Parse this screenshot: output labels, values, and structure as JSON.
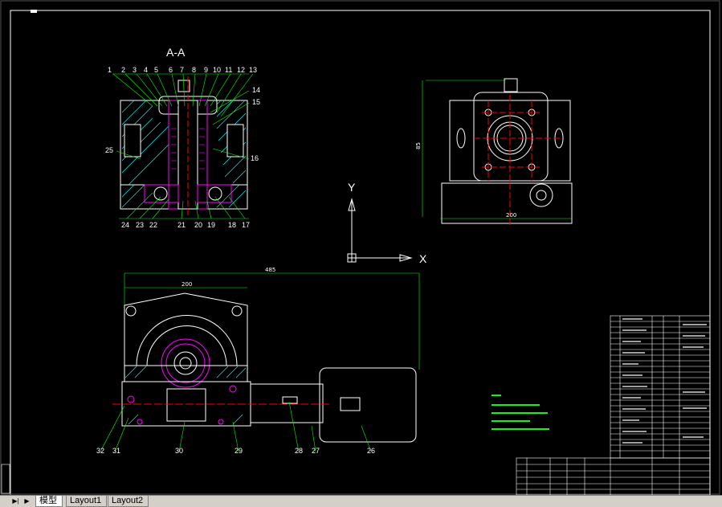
{
  "section_label": "A-A",
  "axis": {
    "x": "X",
    "y": "Y"
  },
  "part_numbers_top": [
    "1",
    "2",
    "3",
    "4",
    "5",
    "6",
    "7",
    "8",
    "9",
    "10",
    "11",
    "12",
    "13"
  ],
  "part_numbers_right": [
    "14",
    "15",
    "16",
    "17"
  ],
  "part_numbers_bottom": [
    "24",
    "23",
    "22",
    "21",
    "20",
    "19",
    "18",
    "17"
  ],
  "part_number_left": "25",
  "plan_part_numbers": [
    "32",
    "31",
    "30",
    "29",
    "28",
    "27",
    "26"
  ],
  "dims": {
    "top_view_width": "200",
    "top_view_height": "85",
    "plan_overall": "485",
    "plan_body": "200"
  },
  "tabs": {
    "model": "模型",
    "layout1": "Layout1",
    "layout2": "Layout2"
  },
  "colors": {
    "border": "#ffffff",
    "dimension": "#00ff00",
    "part": "#ffffff",
    "center": "#ff0000",
    "hatch": "#00ffff",
    "leader": "#ffff00",
    "accent": "#ff00ff"
  }
}
